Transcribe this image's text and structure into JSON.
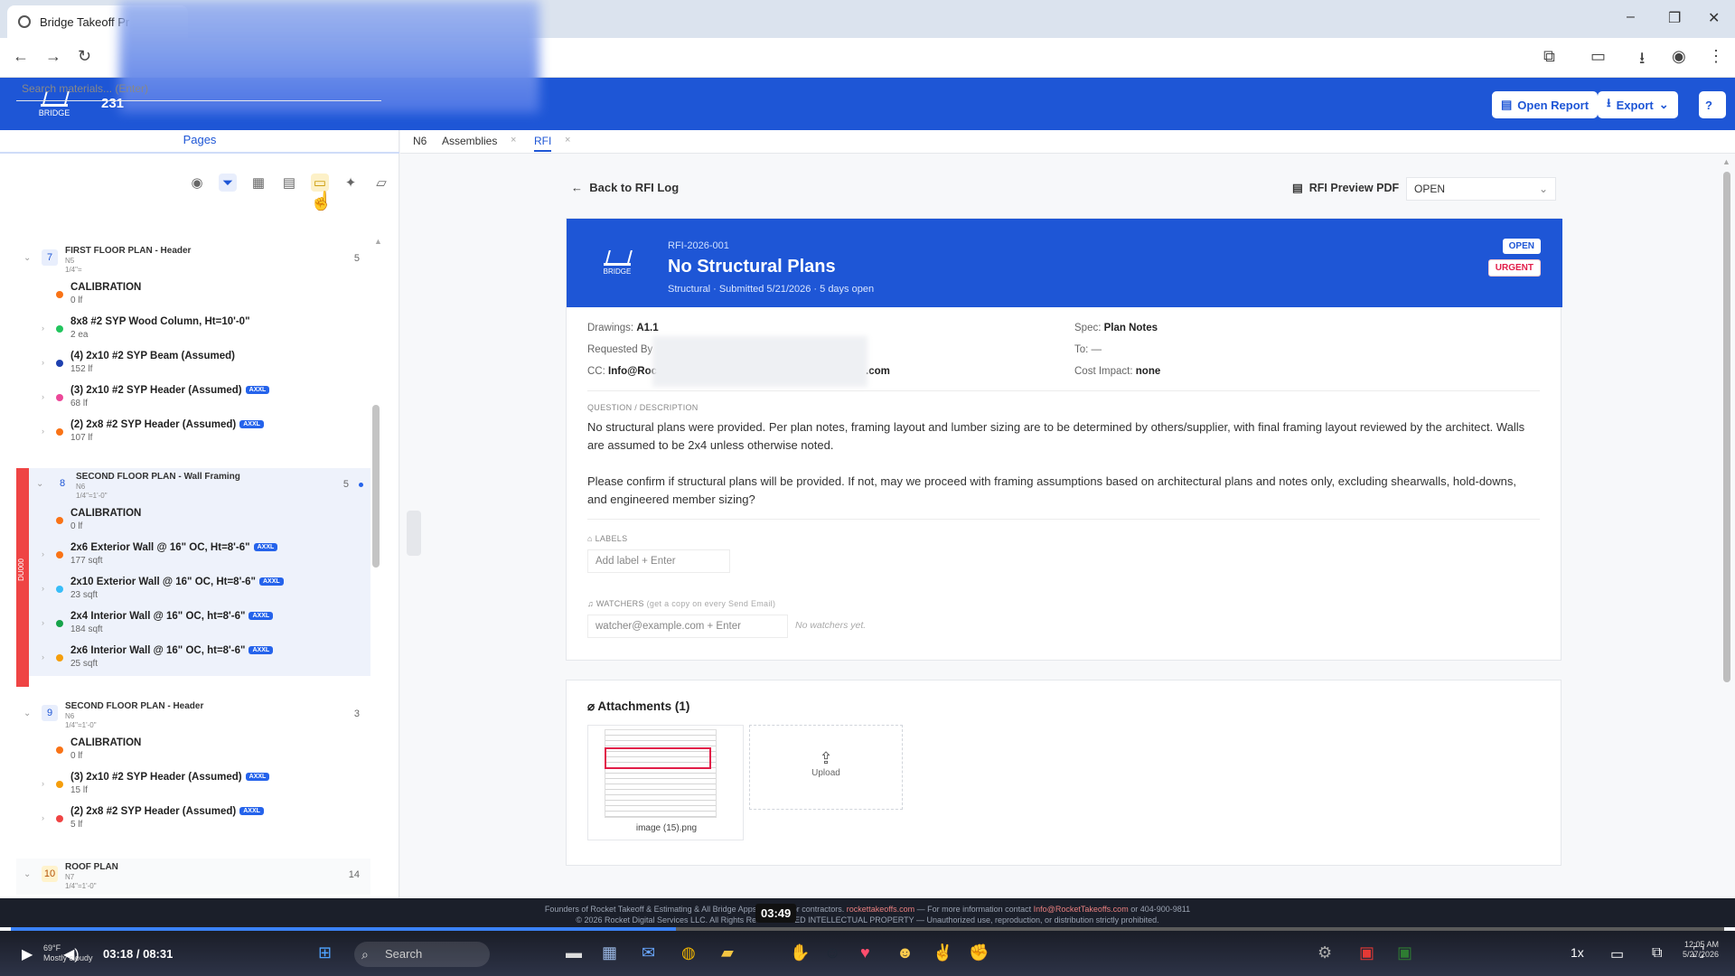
{
  "browser": {
    "tab_title": "Bridge Takeoff Pr",
    "window_controls": [
      "–",
      "❐",
      "✕"
    ]
  },
  "app": {
    "logo_text": "BRIDGE",
    "project_number": "231",
    "open_report_label": "Open Report",
    "export_label": "Export"
  },
  "left_panel": {
    "pages_tab": "Pages",
    "search_placeholder": "Search materials... (Enter)",
    "flag_label": "DU000",
    "groups": [
      {
        "number": "7",
        "title": "FIRST FLOOR PLAN - Header",
        "sheet": "N5",
        "scale": "1/4\"=",
        "count": "5",
        "items": [
          {
            "name": "CALIBRATION",
            "qty": "0 lf",
            "color": "#f97316",
            "badge": ""
          },
          {
            "name": "8x8 #2 SYP Wood Column, Ht=10'-0\"",
            "qty": "2 ea",
            "color": "#22c55e",
            "badge": ""
          },
          {
            "name": "(4) 2x10 #2 SYP Beam (Assumed)",
            "qty": "152 lf",
            "color": "#1e40af",
            "badge": ""
          },
          {
            "name": "(3) 2x10 #2 SYP Header (Assumed)",
            "qty": "68 lf",
            "color": "#ec4899",
            "badge": "AXXL"
          },
          {
            "name": "(2) 2x8 #2 SYP Header (Assumed)",
            "qty": "107 lf",
            "color": "#f97316",
            "badge": "AXXL"
          }
        ]
      },
      {
        "number": "8",
        "title": "SECOND FLOOR PLAN - Wall Framing",
        "sheet": "N6",
        "scale": "1/4\"=1'-0\"",
        "count": "5",
        "items": [
          {
            "name": "CALIBRATION",
            "qty": "0 lf",
            "color": "#f97316",
            "badge": ""
          },
          {
            "name": "2x6 Exterior Wall @ 16\" OC, Ht=8'-6\"",
            "qty": "177 sqft",
            "color": "#f97316",
            "badge": "AXXL"
          },
          {
            "name": "2x10 Exterior Wall @ 16\" OC, Ht=8'-6\"",
            "qty": "23 sqft",
            "color": "#38bdf8",
            "badge": "AXXL"
          },
          {
            "name": "2x4 Interior Wall @ 16\" OC, ht=8'-6\"",
            "qty": "184 sqft",
            "color": "#16a34a",
            "badge": "AXXL"
          },
          {
            "name": "2x6 Interior Wall @ 16\" OC, ht=8'-6\"",
            "qty": "25 sqft",
            "color": "#f59e0b",
            "badge": "AXXL"
          }
        ]
      },
      {
        "number": "9",
        "title": "SECOND FLOOR PLAN - Header",
        "sheet": "N6",
        "scale": "1/4\"=1'-0\"",
        "count": "3",
        "items": [
          {
            "name": "CALIBRATION",
            "qty": "0 lf",
            "color": "#f97316",
            "badge": ""
          },
          {
            "name": "(3) 2x10 #2 SYP Header (Assumed)",
            "qty": "15 lf",
            "color": "#f59e0b",
            "badge": "AXXL"
          },
          {
            "name": "(2) 2x8 #2 SYP Header (Assumed)",
            "qty": "5 lf",
            "color": "#ef4444",
            "badge": "AXXL"
          }
        ]
      },
      {
        "number": "10",
        "title": "ROOF PLAN",
        "sheet": "N7",
        "scale": "1/4\"=1'-0\"",
        "count": "14",
        "items": []
      }
    ]
  },
  "tabs": [
    {
      "label": "N6"
    },
    {
      "label": "Assemblies"
    },
    {
      "label": "RFI"
    }
  ],
  "rfi": {
    "back_label": "Back to RFI Log",
    "preview_pdf_label": "RFI Preview PDF",
    "status_value": "OPEN",
    "id": "RFI-2026-001",
    "title": "No Structural Plans",
    "subtitle": "Structural · Submitted 5/21/2026 · 5 days open",
    "pill_open": "OPEN",
    "pill_urgent": "URGENT",
    "drawings_label": "Drawings:",
    "drawings_value": "A1.1",
    "requested_by_label": "Requested By",
    "cc_label": "CC:",
    "cc_value_start": "Info@Roc",
    "cc_value_end": ".com",
    "spec_label": "Spec:",
    "spec_value": "Plan Notes",
    "to_label": "To:",
    "to_value": "—",
    "cost_label": "Cost Impact:",
    "cost_value": "none",
    "question_heading": "QUESTION / DESCRIPTION",
    "desc_p1": "No structural plans were provided. Per plan notes, framing layout and lumber sizing are to be determined by others/supplier, with final framing layout reviewed by the architect. Walls are assumed to be 2x4 unless otherwise noted.",
    "desc_p2": "Please confirm if structural plans will be provided. If not, may we proceed with framing assumptions based on architectural plans and notes only, excluding shearwalls, hold-downs, and engineered member sizing?",
    "labels_heading": "LABELS",
    "label_placeholder": "Add label + Enter",
    "watchers_heading": "WATCHERS",
    "watchers_note": "(get a copy on every Send Email)",
    "watcher_placeholder": "watcher@example.com + Enter",
    "no_watchers": "No watchers yet.",
    "attachments_title": "Attachments (1)",
    "attachment_name": "image (15).png",
    "upload_label": "Upload"
  },
  "video": {
    "footnote_line1_a": "Founders of Rocket Takeoff & Estimating & All Bridge Apps. Built by ",
    "footnote_line1_b": " for contractors. ",
    "footnote_link1": "rockettakeoffs.com",
    "footnote_line1_c": " — For more information contact ",
    "footnote_link2": "Info@RocketTakeoffs.com",
    "footnote_line1_d": " or 404-900-9811",
    "footnote_line2": "© 2026 Rocket Digital Services LLC. All Rights Reserved. ... ED INTELLECTUAL PROPERTY — Unauthorized use, reproduction, or distribution strictly prohibited.",
    "hover_time": "03:49",
    "current_time": "03:18 / 08:31",
    "progress_fraction": 0.388,
    "speed": "1x",
    "weather_temp": "69°F",
    "weather_desc": "Mostly cloudy",
    "taskbar_search": "Search",
    "clock_time": "12:05 AM",
    "clock_date": "5/27/2026"
  },
  "colors": {
    "brand_blue": "#1e56d6",
    "urgent_red": "#e11d48",
    "flag_red": "#ef4444"
  }
}
